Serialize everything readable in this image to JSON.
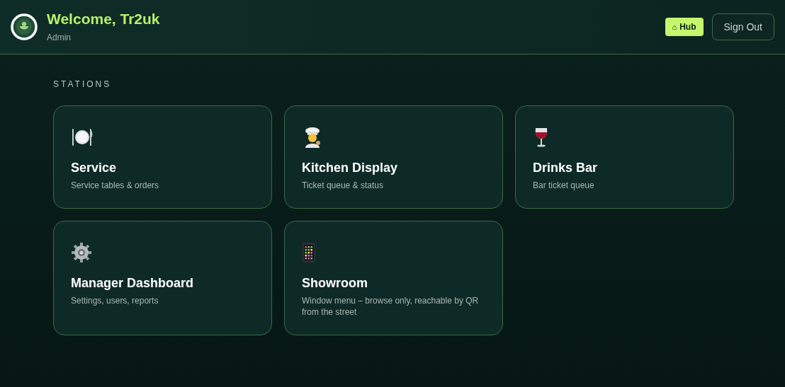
{
  "header": {
    "title": "Welcome, Tr2uk",
    "role": "Admin",
    "hub_icon": "⌂",
    "hub_button": "Hub",
    "sign_out_button": "Sign Out"
  },
  "section_title": "STATIONS",
  "stations": [
    {
      "kind": "plate",
      "title": "Service",
      "description": "Service tables & orders"
    },
    {
      "kind": "chef",
      "title": "Kitchen Display",
      "description": "Ticket queue & status"
    },
    {
      "kind": "wine",
      "title": "Drinks Bar",
      "description": "Bar ticket queue"
    },
    {
      "kind": "gear",
      "title": "Manager Dashboard",
      "description": "Settings, users, reports"
    },
    {
      "kind": "phone",
      "title": "Showroom",
      "description": "Window menu – browse only, reachable by QR from the street"
    }
  ]
}
